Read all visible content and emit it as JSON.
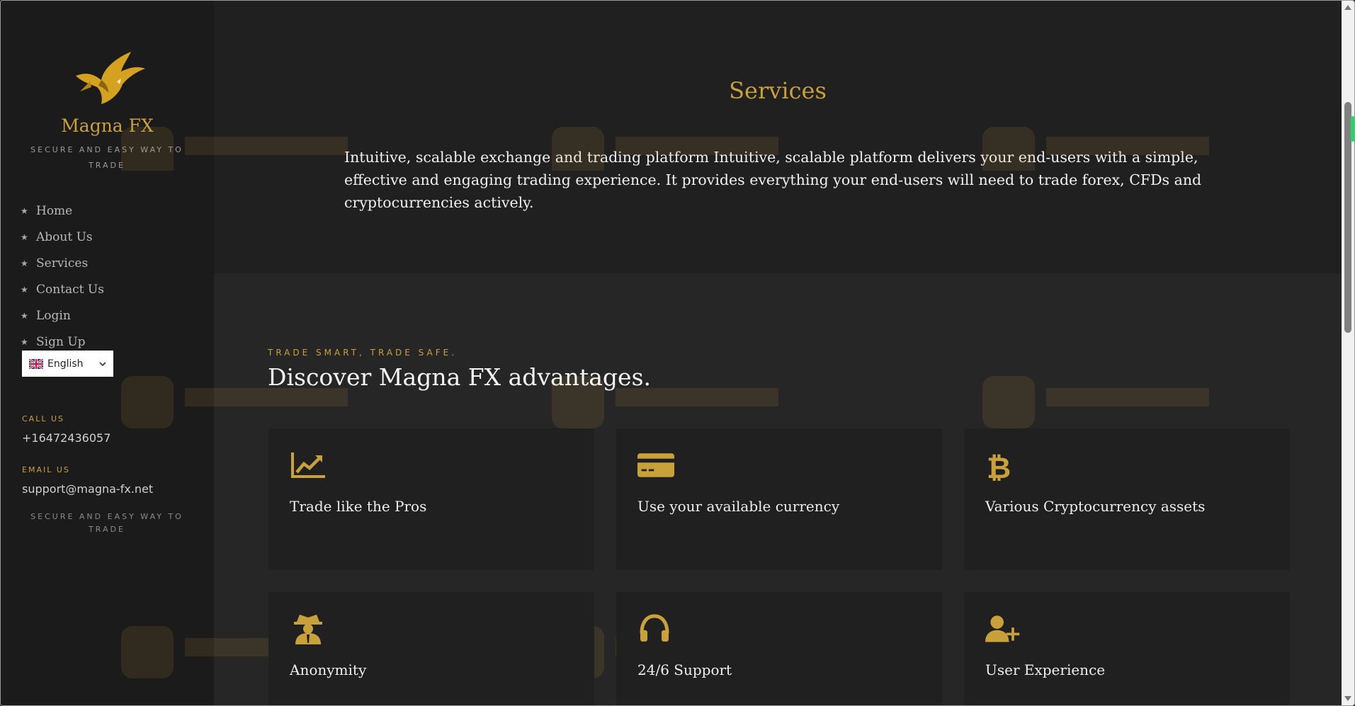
{
  "sidebar": {
    "brand": "Magna FX",
    "tagline": "SECURE AND EASY WAY TO TRADE",
    "nav": [
      {
        "label": "Home"
      },
      {
        "label": "About Us"
      },
      {
        "label": "Services"
      },
      {
        "label": "Contact Us"
      },
      {
        "label": "Login"
      },
      {
        "label": "Sign Up"
      }
    ],
    "language": {
      "selected": "English"
    },
    "call_label": "CALL US",
    "phone": "+16472436057",
    "email_label": "EMAIL US",
    "email": "support@magna-fx.net",
    "footer_tagline": "SECURE AND EASY WAY TO TRADE"
  },
  "hero": {
    "title": "Services",
    "text": "Intuitive, scalable exchange and trading platform Intuitive, scalable platform delivers your end-users with a simple, effective and engaging trading experience. It provides everything your end-users will need to trade forex, CFDs and cryptocurrencies actively."
  },
  "advantages": {
    "kicker": "TRADE SMART, TRADE SAFE.",
    "title": "Discover Magna FX advantages.",
    "cards": [
      {
        "label": "Trade like the Pros",
        "icon": "chart-line-icon"
      },
      {
        "label": "Use your available currency",
        "icon": "credit-card-icon"
      },
      {
        "label": "Various Cryptocurrency assets",
        "icon": "bitcoin-icon"
      },
      {
        "label": "Anonymity",
        "icon": "user-secret-icon"
      },
      {
        "label": "24/6 Support",
        "icon": "headphones-icon"
      },
      {
        "label": "User Experience",
        "icon": "user-plus-icon"
      }
    ]
  },
  "colors": {
    "accent": "#c9a13a",
    "background": "#212121",
    "sidebar": "#1b1b1b"
  }
}
